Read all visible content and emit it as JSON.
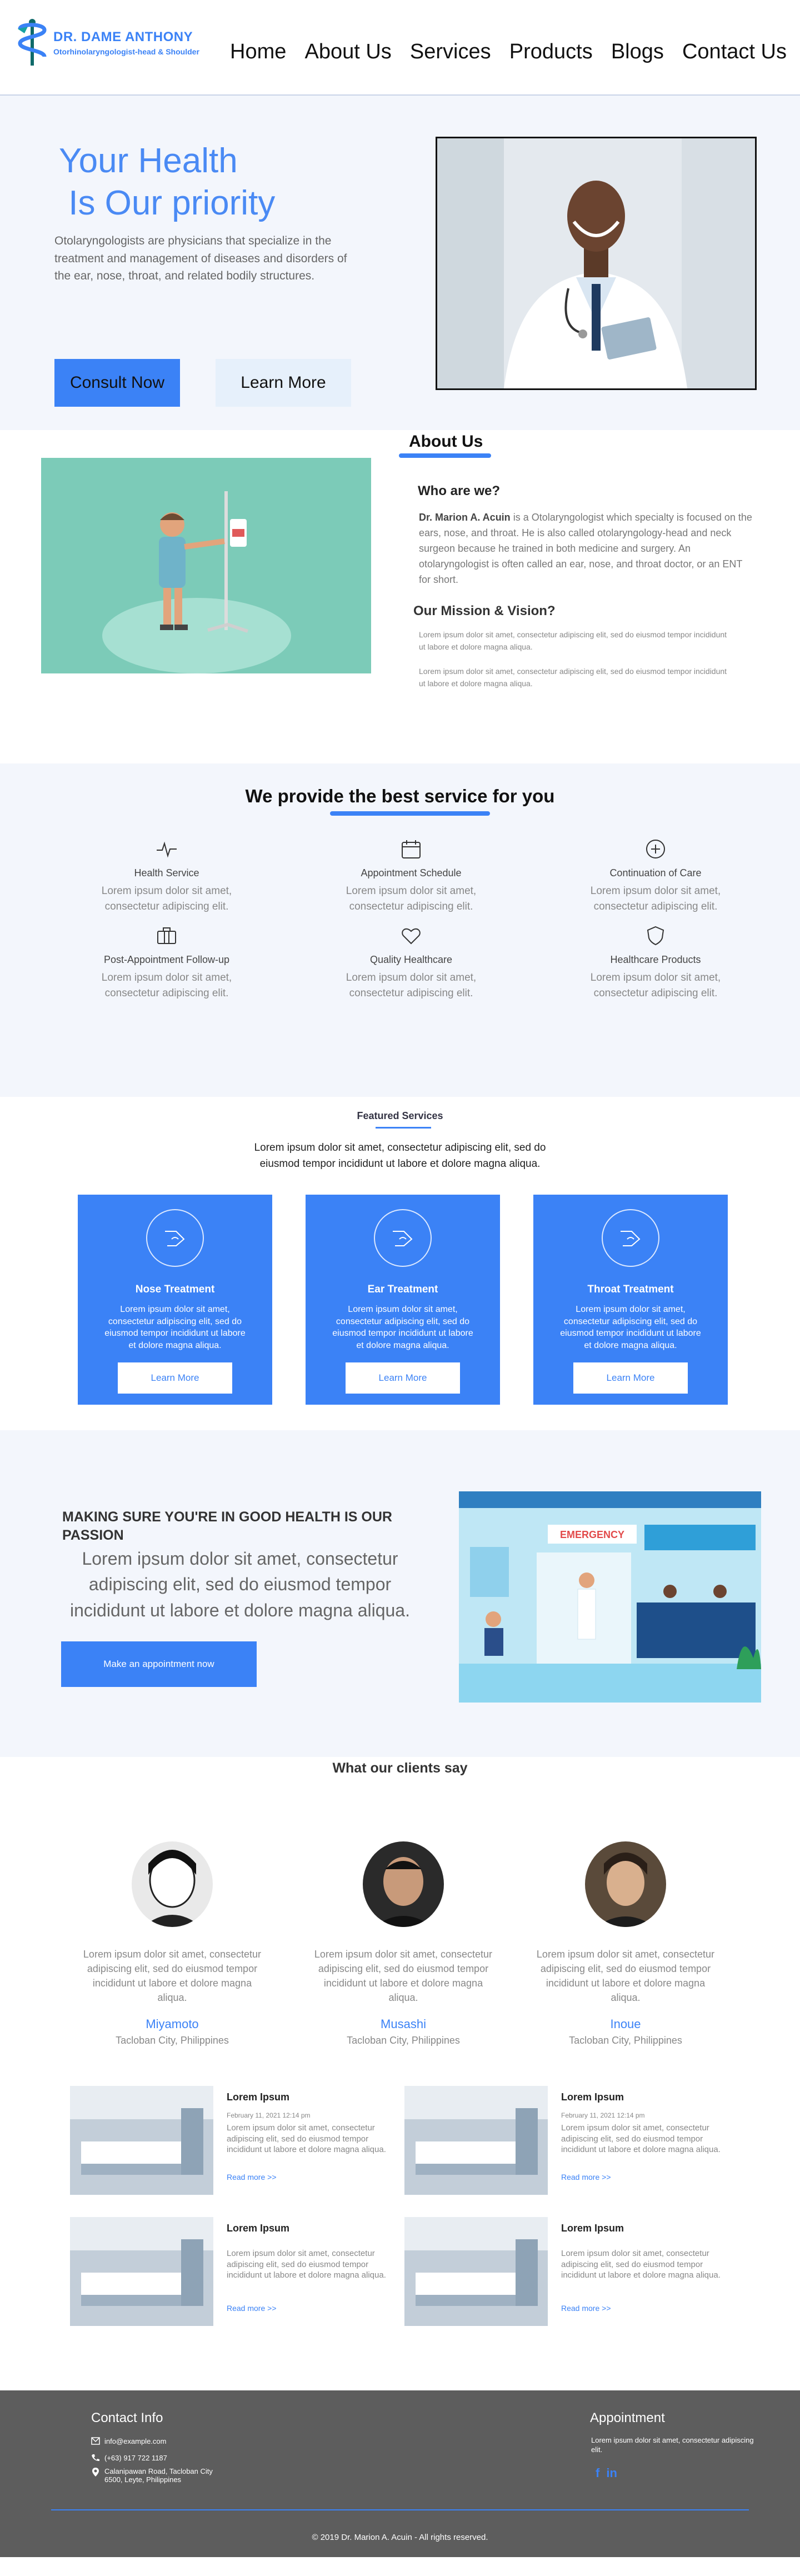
{
  "header": {
    "logo_name": "DR. DAME ANTHONY",
    "logo_sub": "Otorhinolaryngologist-head & Shoulder",
    "nav": [
      "Home",
      "About Us",
      "Services",
      "Products",
      "Blogs",
      "Contact Us"
    ]
  },
  "hero": {
    "title_line1": "Your Health",
    "title_line2": "Is Our priority",
    "description": "Otolaryngologists are physicians that specialize in the treatment and management of diseases and disorders of the ear, nose, throat, and related bodily structures.",
    "consult_label": "Consult Now",
    "learn_label": "Learn More"
  },
  "about": {
    "heading": "About Us",
    "who_title": "Who are we?",
    "who_name": "Dr. Marion A. Acuin",
    "who_text": " is a Otolaryngologist  which specialty is focused on the ears, nose, and throat. He is also called otolaryngology-head and neck surgeon because he trained in both medicine and surgery. An otolaryngologist is often called an ear, nose, and throat doctor, or an ENT for short.",
    "mission_title": "Our Mission & Vision?",
    "mission_text1": "Lorem ipsum dolor sit amet, consectetur adipiscing elit, sed do eiusmod tempor incididunt ut labore et dolore magna aliqua.",
    "mission_text2": "Lorem ipsum dolor sit amet, consectetur adipiscing elit, sed do eiusmod tempor incididunt ut labore et dolore magna aliqua."
  },
  "services": {
    "title": "We provide the best service for you",
    "items": [
      {
        "title": "Health Service",
        "text": "Lorem ipsum dolor sit amet, consectetur adipiscing elit.",
        "icon": "pulse-icon"
      },
      {
        "title": "Appointment Schedule",
        "text": "Lorem ipsum dolor sit amet, consectetur adipiscing elit.",
        "icon": "calendar-icon"
      },
      {
        "title": "Continuation of Care",
        "text": "Lorem ipsum dolor sit amet, consectetur adipiscing elit.",
        "icon": "plus-circle-icon"
      },
      {
        "title": "Post-Appointment Follow-up",
        "text": "Lorem ipsum dolor sit amet, consectetur adipiscing elit.",
        "icon": "briefcase-icon"
      },
      {
        "title": "Quality Healthcare",
        "text": "Lorem ipsum dolor sit amet, consectetur adipiscing elit.",
        "icon": "heart-icon"
      },
      {
        "title": "Healthcare Products",
        "text": "Lorem ipsum dolor sit amet, consectetur adipiscing elit.",
        "icon": "shield-icon"
      }
    ]
  },
  "featured": {
    "title": "Featured Services",
    "description": "Lorem ipsum dolor sit amet, consectetur adipiscing elit, sed do eiusmod tempor incididunt ut labore et dolore magna aliqua.",
    "cards": [
      {
        "title": "Nose Treatment",
        "text": "Lorem ipsum dolor sit amet, consectetur adipiscing elit, sed do eiusmod tempor incididunt ut labore et dolore magna aliqua.",
        "button": "Learn More"
      },
      {
        "title": "Ear Treatment",
        "text": "Lorem ipsum dolor sit amet, consectetur adipiscing elit, sed do eiusmod tempor incididunt ut labore et dolore magna aliqua.",
        "button": "Learn More"
      },
      {
        "title": "Throat Treatment",
        "text": "Lorem ipsum dolor sit amet, consectetur adipiscing elit, sed do eiusmod tempor incididunt ut labore et dolore magna aliqua.",
        "button": "Learn More"
      }
    ]
  },
  "passion": {
    "title": "MAKING SURE YOU'RE IN GOOD HEALTH IS OUR PASSION",
    "text": "Lorem ipsum dolor sit amet, consectetur adipiscing elit, sed do eiusmod tempor incididunt ut labore et dolore magna aliqua.",
    "button": "Make an appointment now",
    "sign": "EMERGENCY"
  },
  "testimonials": {
    "title": "What our clients say",
    "people": [
      {
        "text": "Lorem ipsum dolor sit amet, consectetur adipiscing elit, sed do eiusmod tempor incididunt ut labore et dolore magna aliqua.",
        "name": "Miyamoto",
        "location": "Tacloban City, Philippines"
      },
      {
        "text": "Lorem ipsum dolor sit amet, consectetur adipiscing elit, sed do eiusmod tempor incididunt ut labore et dolore magna aliqua.",
        "name": "Musashi",
        "location": "Tacloban City, Philippines"
      },
      {
        "text": "Lorem ipsum dolor sit amet, consectetur adipiscing elit, sed do eiusmod tempor incididunt ut labore et dolore magna aliqua.",
        "name": "Inoue",
        "location": "Tacloban City, Philippines"
      }
    ]
  },
  "blog": {
    "posts": [
      {
        "title": "Lorem Ipsum",
        "date": "February 11, 2021 12:14 pm",
        "text": "Lorem ipsum dolor sit amet, consectetur adipiscing elit, sed do eiusmod tempor incididunt ut labore et dolore magna aliqua.",
        "more": "Read more >>"
      },
      {
        "title": "Lorem Ipsum",
        "date": "February 11, 2021 12:14 pm",
        "text": "Lorem ipsum dolor sit amet, consectetur adipiscing elit, sed do eiusmod tempor incididunt ut labore et dolore magna aliqua.",
        "more": "Read more >>"
      },
      {
        "title": "Lorem Ipsum",
        "date": "",
        "text": "Lorem ipsum dolor sit amet, consectetur adipiscing elit, sed do eiusmod tempor incididunt ut labore et dolore magna aliqua.",
        "more": "Read more >>"
      },
      {
        "title": "Lorem Ipsum",
        "date": "",
        "text": "Lorem ipsum dolor sit amet, consectetur adipiscing elit, sed do eiusmod tempor incididunt ut labore et dolore magna aliqua.",
        "more": "Read more >>"
      }
    ]
  },
  "footer": {
    "contact_title": "Contact Info",
    "email": "info@example.com",
    "phone": "(+63) 917 722 1187",
    "address_line1": "Calanipawan Road, Tacloban City",
    "address_line2": "6500, Leyte, Philippines",
    "appointment_title": "Appointment",
    "appointment_text": "Lorem ipsum dolor sit amet, consectetur adipiscing elit.",
    "social": [
      "f",
      "in"
    ],
    "copyright": "© 2019 Dr. Marion A. Acuin - All rights reserved."
  },
  "colors": {
    "accent": "#3b82f6",
    "section_bg": "#f3f6fc",
    "footer_bg": "#5d5d5d"
  }
}
